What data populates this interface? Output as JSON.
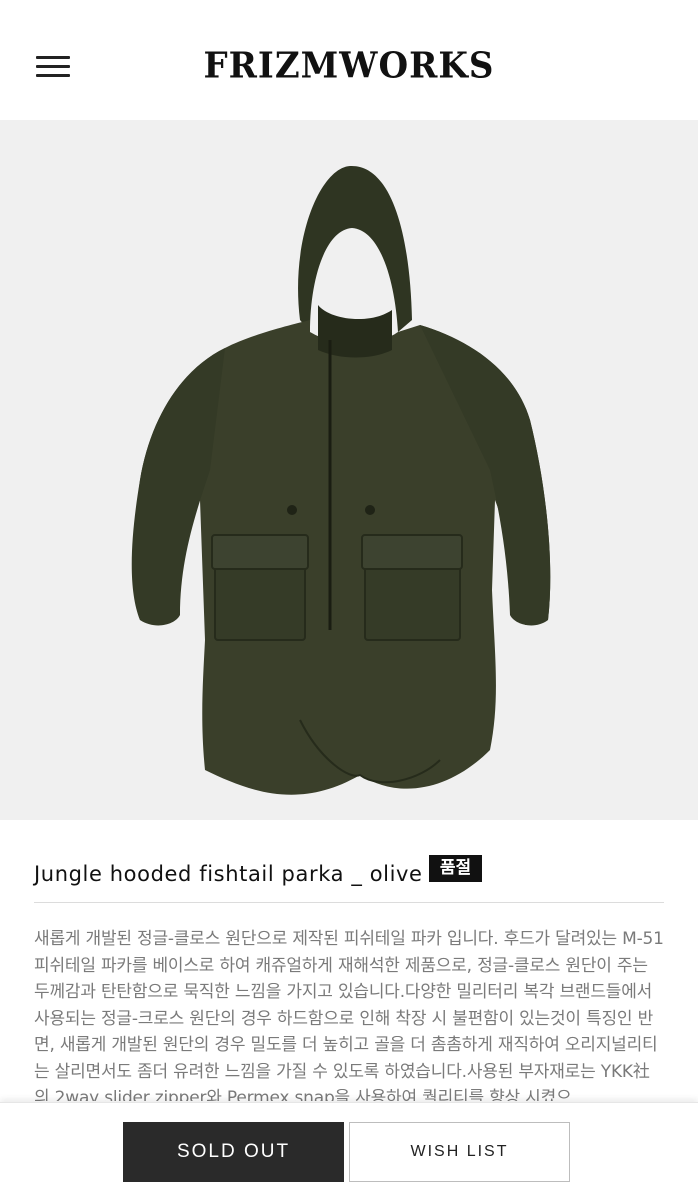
{
  "header": {
    "logo": "FRIZMWORKS",
    "menu_icon": "hamburger-icon"
  },
  "product": {
    "title": "Jungle hooded fishtail parka _ olive",
    "badge": "품절",
    "description": "새롭게 개발된 정글-클로스 원단으로 제작된 피쉬테일 파카 입니다. 후드가 달려있는 M-51 피쉬테일 파카를 베이스로 하여 캐쥬얼하게 재해석한 제품으로, 정글-클로스 원단이 주는 두께감과 탄탄함으로 묵직한 느낌을 가지고 있습니다.다양한 밀리터리 복각 브랜드들에서 사용되는 정글-크로스 원단의 경우 하드함으로 인해 착장 시 불편함이 있는것이 특징인 반면, 새롭게 개발된 원단의 경우 밀도를 더 높히고 골을 더 촘촘하게 재직하여 오리지널리티는 살리면서도 좀더 유려한 느낌을 가질 수 있도록 하였습니다.사용된 부자재로는 YKK社의 2way slider zipper와 Permex snap을 사용하여 퀄리티를 향상 시켰으",
    "image_color": "#3a3f2a"
  },
  "actions": {
    "sold_out_label": "SOLD OUT",
    "wish_list_label": "WISH LIST"
  }
}
